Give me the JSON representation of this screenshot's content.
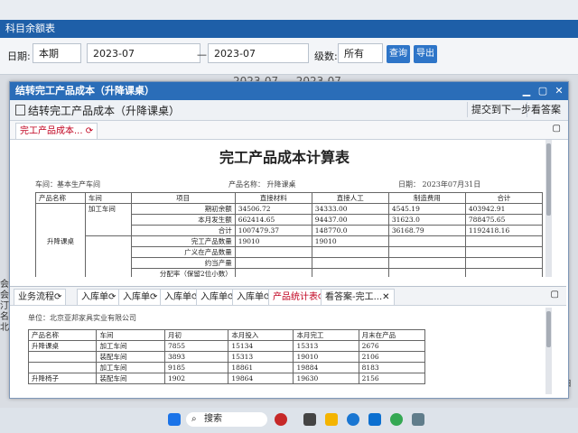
{
  "background": {
    "window_title": "科目余额表",
    "filter": {
      "date_label": "日期:",
      "period_value": "本期",
      "date_from": "2023-07",
      "separator": "—",
      "date_to": "2023-07",
      "level_label": "级数:",
      "level_value": "所有",
      "query_button": "查询",
      "export_button": "导出"
    },
    "behind_text": "2023-07 — 2023-07",
    "left_fragments": [
      "会计",
      "会计期",
      "汀明日",
      "名称:  北"
    ],
    "right_fragment": "业务日期:"
  },
  "window": {
    "title": "结转完工产品成本（升降课桌）",
    "toolbar_title": "结转完工产品成本（升降课桌）",
    "submit_button": "提交到下一步",
    "answer_button": "看答案",
    "tab1": "完工产品成本...",
    "doc": {
      "title": "完工产品成本计算表",
      "workshop": "车间：基本生产车间",
      "product": "产品名称：  升降课桌",
      "date": "日期：  2023年07月31日",
      "headers": [
        "产品名称",
        "车间",
        "项目",
        "直接材料",
        "直接人工",
        "制造费用",
        "合计"
      ],
      "product_name": "升降课桌",
      "workshop_cell": "加工车间",
      "rows": [
        {
          "item": "期初余额",
          "material": "34506.72",
          "labor": "34333.00",
          "overhead": "4545.19",
          "total": "403942.91"
        },
        {
          "item": "本月发生额",
          "material": "662414.65",
          "labor": "94437.00",
          "overhead": "31623.0",
          "total": "788475.65"
        },
        {
          "item": "合计",
          "material": "1007479.37",
          "labor": "148770.0",
          "overhead": "36168.79",
          "total": "1192418.16"
        },
        {
          "item": "完工产品数量",
          "material": "19010",
          "labor": "19010",
          "overhead": "",
          "total": ""
        },
        {
          "item": "广义在产品数量",
          "material": "",
          "labor": "",
          "overhead": "",
          "total": ""
        },
        {
          "item": "约当产量",
          "material": "",
          "labor": "",
          "overhead": "",
          "total": ""
        },
        {
          "item": "分配率（保留2位小数）",
          "material": "",
          "labor": "",
          "overhead": "",
          "total": ""
        }
      ]
    },
    "tabs2": [
      "业务流程",
      "入库单",
      "入库单",
      "入库单",
      "入库单",
      "入库单",
      "产品统计表",
      "看答案-完工..."
    ],
    "sheet2": {
      "company": "单位：北京亚邦家具实业有限公司",
      "headers": [
        "产品名称",
        "车间",
        "月初",
        "本月投入",
        "本月完工",
        "月末在产品"
      ],
      "rows": [
        {
          "product": "",
          "workshop": "加工车间",
          "c1": "7855",
          "c2": "15134",
          "c3": "15313",
          "c4": "2676"
        },
        {
          "product": "升降课桌",
          "workshop": "加工车间",
          "c1": "7855",
          "c2": "15134",
          "c3": "15313",
          "c4": "2676"
        },
        {
          "product": "",
          "workshop": "装配车间",
          "c1": "3893",
          "c2": "15313",
          "c3": "19010",
          "c4": "2106"
        },
        {
          "product": "",
          "workshop": "加工车间",
          "c1": "9185",
          "c2": "18861",
          "c3": "19884",
          "c4": "8183"
        },
        {
          "product": "升降椅子",
          "workshop": "装配车间",
          "c1": "1902",
          "c2": "19864",
          "c3": "19630",
          "c4": "2156"
        }
      ]
    }
  },
  "taskbar": {
    "search_placeholder": "搜索"
  }
}
